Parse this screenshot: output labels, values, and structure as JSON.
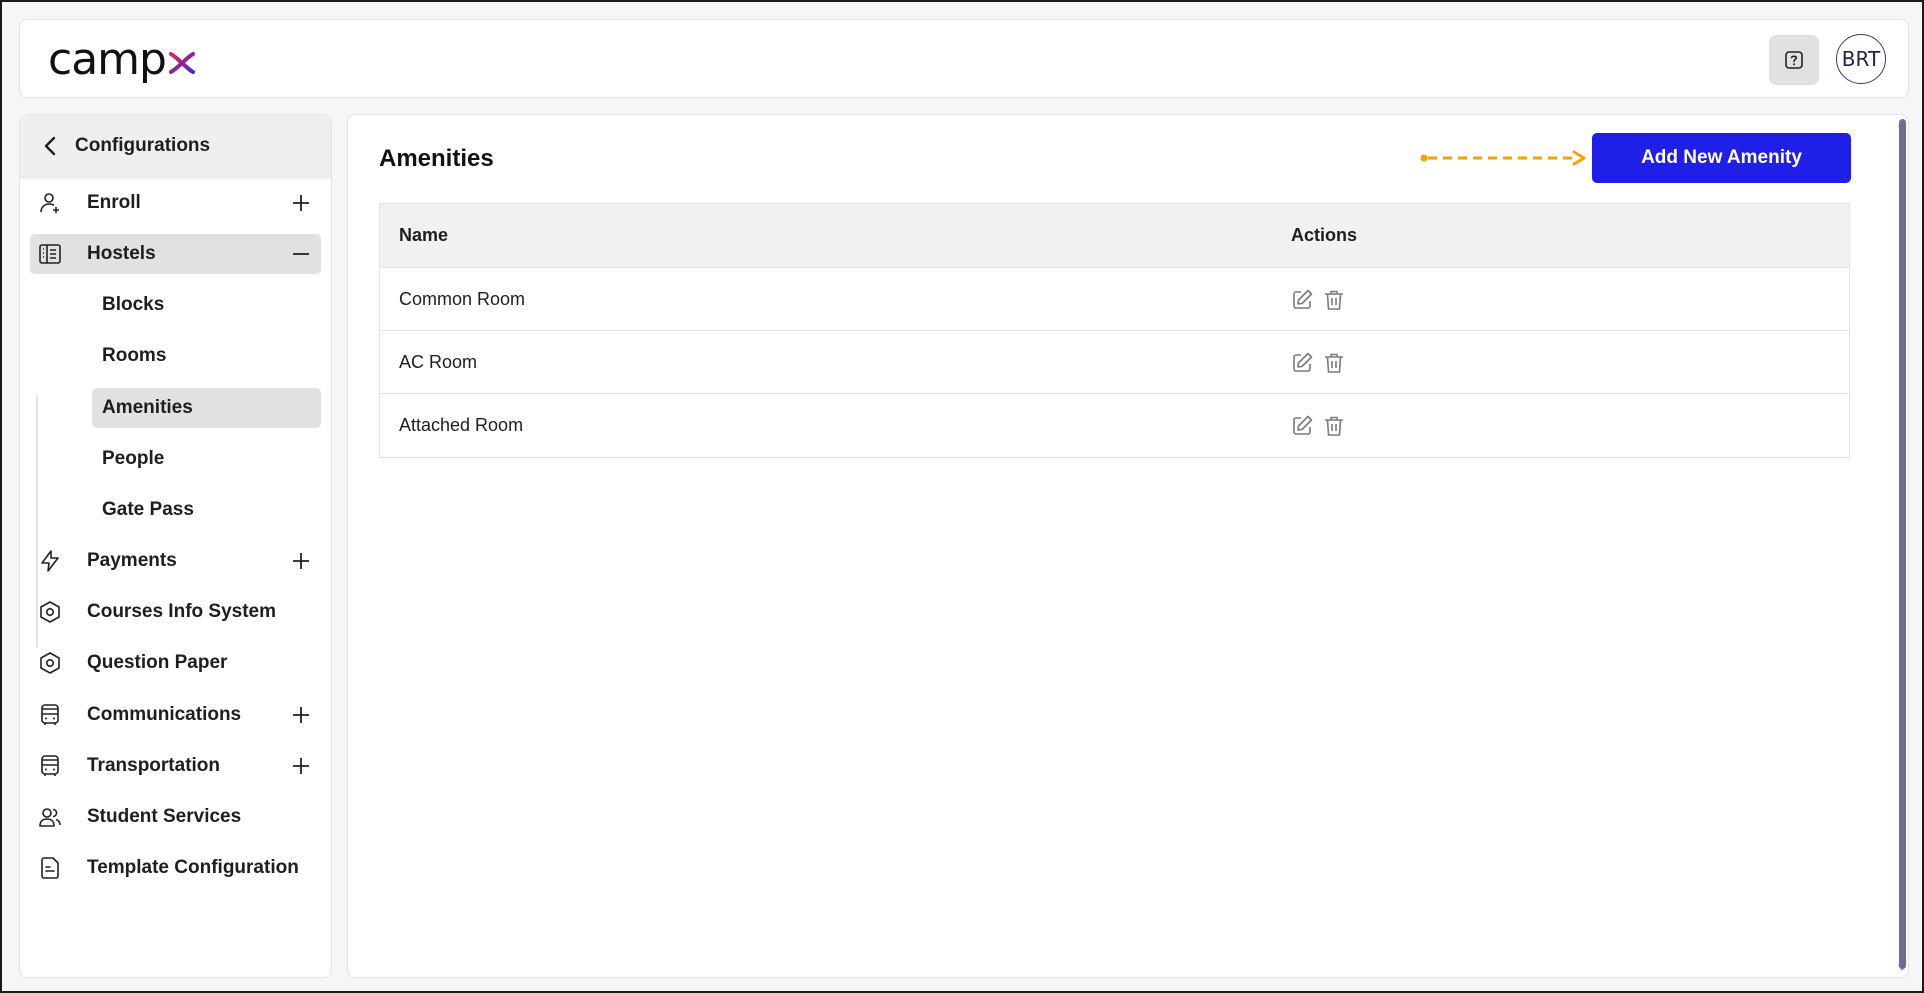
{
  "header": {
    "logo": {
      "text": "camp",
      "accent": "x"
    },
    "help_icon": "help-question-icon",
    "avatar_text": "BRT"
  },
  "sidebar": {
    "title": "Configurations",
    "items": [
      {
        "label": "Enroll",
        "icon": "user-add-icon",
        "toggle": "plus"
      },
      {
        "label": "Hostels",
        "icon": "building-icon",
        "toggle": "minus",
        "expanded": true
      },
      {
        "label": "Payments",
        "icon": "lightning-icon",
        "toggle": "plus"
      },
      {
        "label": "Courses Info System",
        "icon": "hexagon-icon"
      },
      {
        "label": "Question Paper",
        "icon": "hexagon-icon"
      },
      {
        "label": "Communications",
        "icon": "bus-icon",
        "toggle": "plus"
      },
      {
        "label": "Transportation",
        "icon": "bus-icon",
        "toggle": "plus"
      },
      {
        "label": "Student Services",
        "icon": "users-icon"
      },
      {
        "label": "Template Configuration",
        "icon": "document-icon"
      }
    ],
    "hostels_sub": [
      {
        "label": "Blocks"
      },
      {
        "label": "Rooms"
      },
      {
        "label": "Amenities",
        "active": true
      },
      {
        "label": "People"
      },
      {
        "label": "Gate Pass"
      }
    ]
  },
  "main": {
    "title": "Amenities",
    "add_button": "Add New Amenity",
    "columns": [
      "Name",
      "Actions"
    ],
    "rows": [
      {
        "name": "Common Room"
      },
      {
        "name": "AC Room"
      },
      {
        "name": "Attached Room"
      }
    ]
  },
  "colors": {
    "accent": "#1f1fe8",
    "logo_x_start": "#e0245e",
    "logo_x_end": "#3b2bd9",
    "arrow": "#f5a300",
    "active_bg": "#e1e1e4",
    "scrollbar": "#6d6c95"
  }
}
